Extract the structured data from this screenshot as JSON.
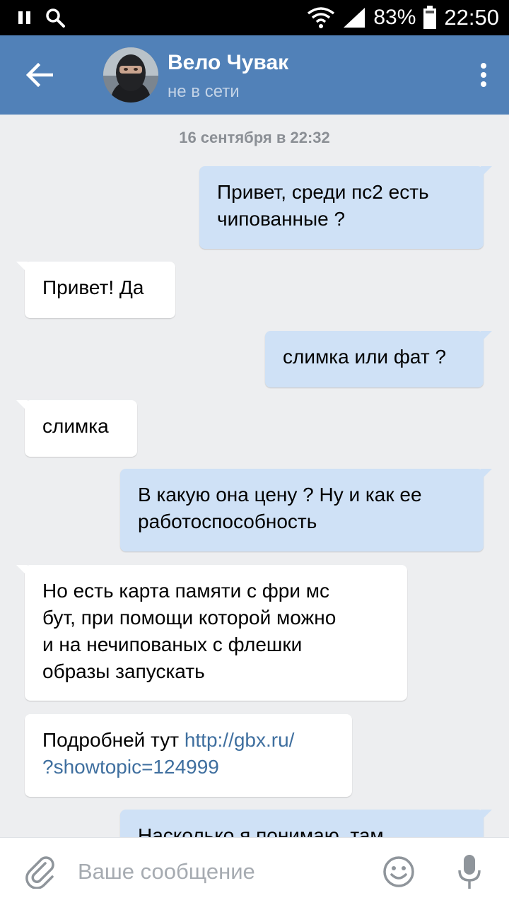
{
  "status_bar": {
    "battery": "83%",
    "time": "22:50",
    "icons": [
      "pause-icon",
      "search-icon",
      "wifi-icon",
      "signal-icon",
      "battery-icon"
    ]
  },
  "header": {
    "name": "Вело Чувак",
    "status": "не в сети",
    "background": "#5181b8"
  },
  "date_separator": "16 сентября в 22:32",
  "messages": [
    {
      "direction": "out",
      "lines": [
        "Привет, среди пс2 есть",
        "чипованные ?"
      ]
    },
    {
      "direction": "in",
      "lines": [
        "Привет! Да"
      ]
    },
    {
      "direction": "out",
      "lines": [
        "слимка или фат ?"
      ]
    },
    {
      "direction": "in",
      "lines": [
        "слимка"
      ]
    },
    {
      "direction": "out",
      "lines": [
        "В какую она цену ? Ну и как ее",
        "работоспособность"
      ]
    },
    {
      "direction": "in",
      "lines": [
        "Но есть карта памяти с фри мс",
        "бут, при помощи которой можно",
        "и на нечипованых с флешки",
        "образы запускать"
      ]
    },
    {
      "direction": "in",
      "text": "Подробней тут ",
      "link_lines": [
        "http://gbx.ru/",
        "?showtopic=124999"
      ]
    },
    {
      "direction": "out",
      "lines": [
        "Насколько я понимаю, там"
      ]
    }
  ],
  "composer": {
    "placeholder": "Ваше сообщение"
  },
  "colors": {
    "outgoing_bubble": "#cfe1f6",
    "incoming_bubble": "#ffffff",
    "link": "#3f6f9f",
    "chat_background": "#edeef0"
  }
}
